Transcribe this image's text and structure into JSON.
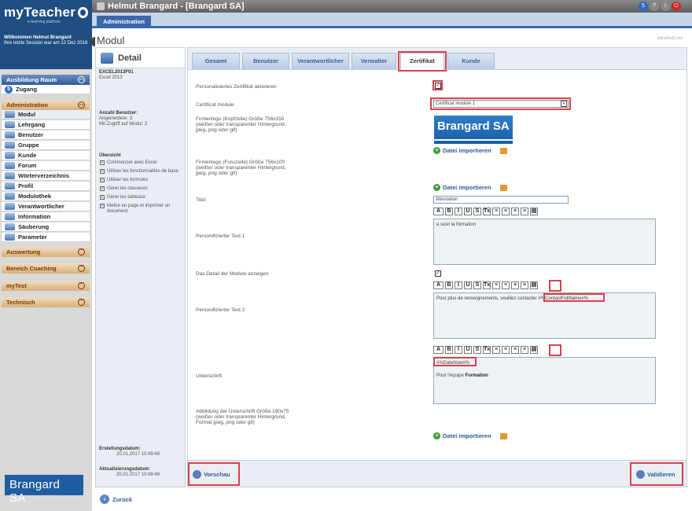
{
  "sidebar": {
    "brand": "myTeacher",
    "brand_sub": "e-learning platform",
    "welcome_line1": "Willkommen Helmut Brangard",
    "welcome_line2": "Ihre letzte Session war am 12 Dez 2018",
    "sections": {
      "ausbildung": "Ausbildung Raum",
      "zugang": "Zugang",
      "administration": "Administration",
      "auswertung": "Auswertung",
      "coaching": "Bereich Coaching",
      "mytest": "myTest",
      "technisch": "Technisch"
    },
    "items": [
      "Modul",
      "Lehrgang",
      "Benutzer",
      "Gruppe",
      "Kunde",
      "Forum",
      "Wörterverzeichnis",
      "Profil",
      "Modulothek",
      "Verantwortlicher",
      "Information",
      "Säuberung",
      "Parameter"
    ],
    "bottom_logo": "Brangard SA"
  },
  "topbar": {
    "title": "Helmut Brangard - [Brangard SA]",
    "badge": "5"
  },
  "nav": {
    "admin_tab": "Administration"
  },
  "page": {
    "title": "Modul",
    "code": "AdmModCertif"
  },
  "detail": {
    "heading": "Detail",
    "code": "EXCEL2013F01",
    "name": "Excel 2013",
    "users_title": "Anzahl Benutzer:",
    "users_line1": "Angemeldete: 3",
    "users_line2": "Mit Zugriff auf Modul: 2",
    "overview_title": "Übersicht",
    "overview": [
      "Commencer avec Excel",
      "Utiliser les fonctionnalités de base",
      "Utiliser les formules",
      "Gérer les classeurs",
      "Gérer les tableaux",
      "Mettre en page et imprimer un document"
    ],
    "created_label": "Erstellungsdatum:",
    "created": "20.01.2017 10:49:48",
    "updated_label": "Aktualisierungsdatum:",
    "updated": "20.01.2017 10:49:48"
  },
  "tabs": [
    "Gesamt",
    "Benutzer",
    "Verantwortlicher",
    "Verwalter",
    "Zertifikat",
    "Kunde"
  ],
  "form": {
    "activate_label": "Personalisiertes Zertifikat aktivieren",
    "cert_module_label": "Certificat module",
    "cert_module_value": "Certificat module 1",
    "header_logo_label": "Firmenlogo (Kopfzeile) Größe 756x150 (weißer oder transparenter Hintergrund, jpeg, png oder gif)",
    "header_logo_text": "Brangard SA",
    "import_label": "Datei importieren",
    "footer_logo_label": "Firmenlogo (Fusszeile) Größe 756x100 (weißer oder transparenter Hintergrund, jpeg, png oder gif)",
    "title_label": "Titel",
    "title_value": "Attestation",
    "text1_label": "Personifizierter Text 1",
    "text1_value": "a suivi la formation",
    "details_label": "Das Detail der Module anzeigen",
    "text2_label": "Personifizierter Text 2",
    "text2_value": "Pour plus de renseignements, veuillez contacter",
    "text2_tag": "#%ContactFullName#%",
    "signature_label": "Unterschrift",
    "signature_tag": "#%DateNow#%",
    "signature_text": "Pour l'équipe",
    "signature_bold": "Formation",
    "sig_image_label": "Abbildung der Unterschrift Größe 190x75 (weißer oder transparenter Hintergrund, Format jpeg, png oder gif)"
  },
  "toolbar": [
    "A",
    "B",
    "I",
    "U",
    "S",
    "Tx",
    "≡",
    "≡",
    "≡",
    "≡",
    "▤"
  ],
  "footer": {
    "preview": "Vorschau",
    "validate": "Validieren",
    "back": "Zurück"
  }
}
